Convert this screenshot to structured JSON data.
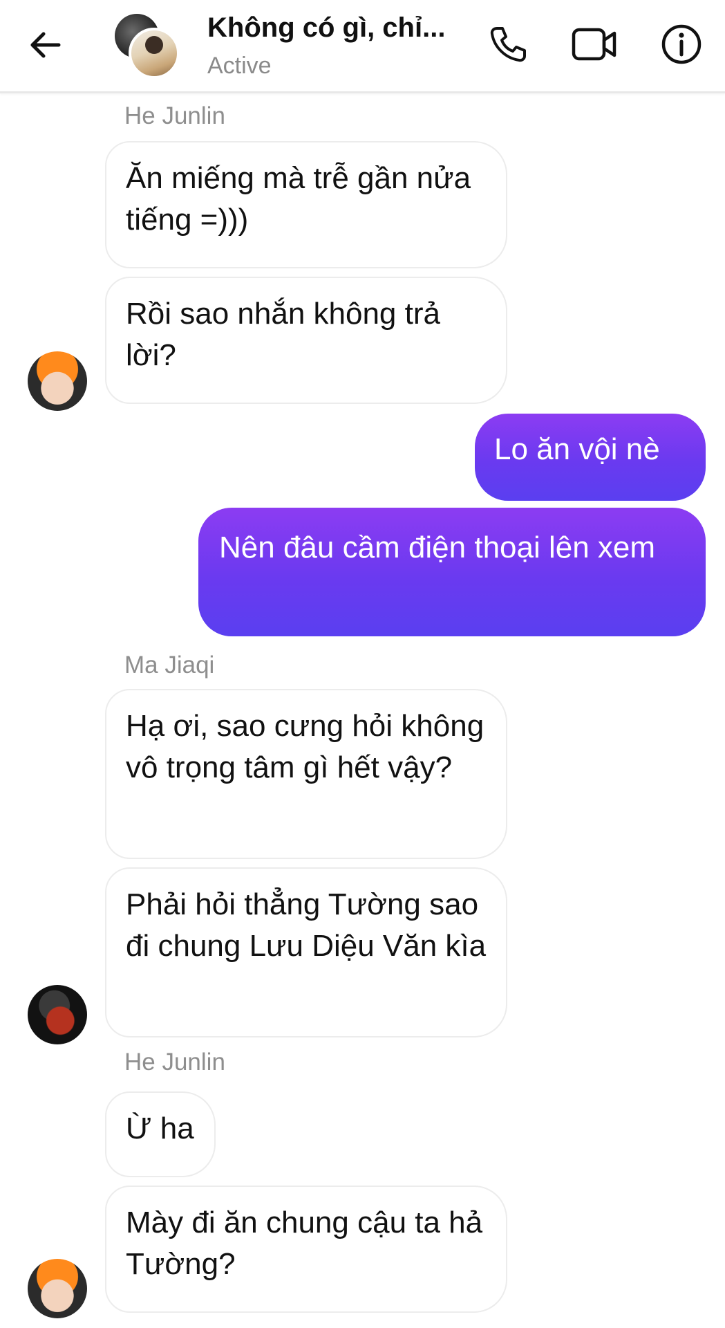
{
  "header": {
    "title": "Không có gì, chỉ...",
    "status": "Active",
    "icons": [
      "back-arrow-icon",
      "phone-icon",
      "video-camera-icon",
      "info-icon"
    ]
  },
  "colors": {
    "outgoing_gradient_start": "#8c3cf2",
    "outgoing_gradient_end": "#5a3ff0",
    "incoming_bg": "#ffffff",
    "sender_name": "#8e8e8e"
  },
  "messages": [
    {
      "sender": "He Junlin",
      "text": "Ăn miếng mà trễ gần nửa tiếng =)))"
    },
    {
      "text": "Rồi sao nhắn không trả lời?"
    },
    {
      "text": "Lo ăn vội nè"
    },
    {
      "text": "Nên đâu cầm điện thoại lên xem"
    },
    {
      "sender": "Ma Jiaqi",
      "text": "Hạ ơi, sao cưng hỏi không vô trọng tâm gì hết vậy?"
    },
    {
      "text": "Phải hỏi thẳng Tường sao đi chung Lưu Diệu Văn kìa"
    },
    {
      "sender": "He Junlin",
      "text": "Ừ ha"
    },
    {
      "text": "Mày đi ăn chung cậu ta hả Tường?"
    }
  ]
}
